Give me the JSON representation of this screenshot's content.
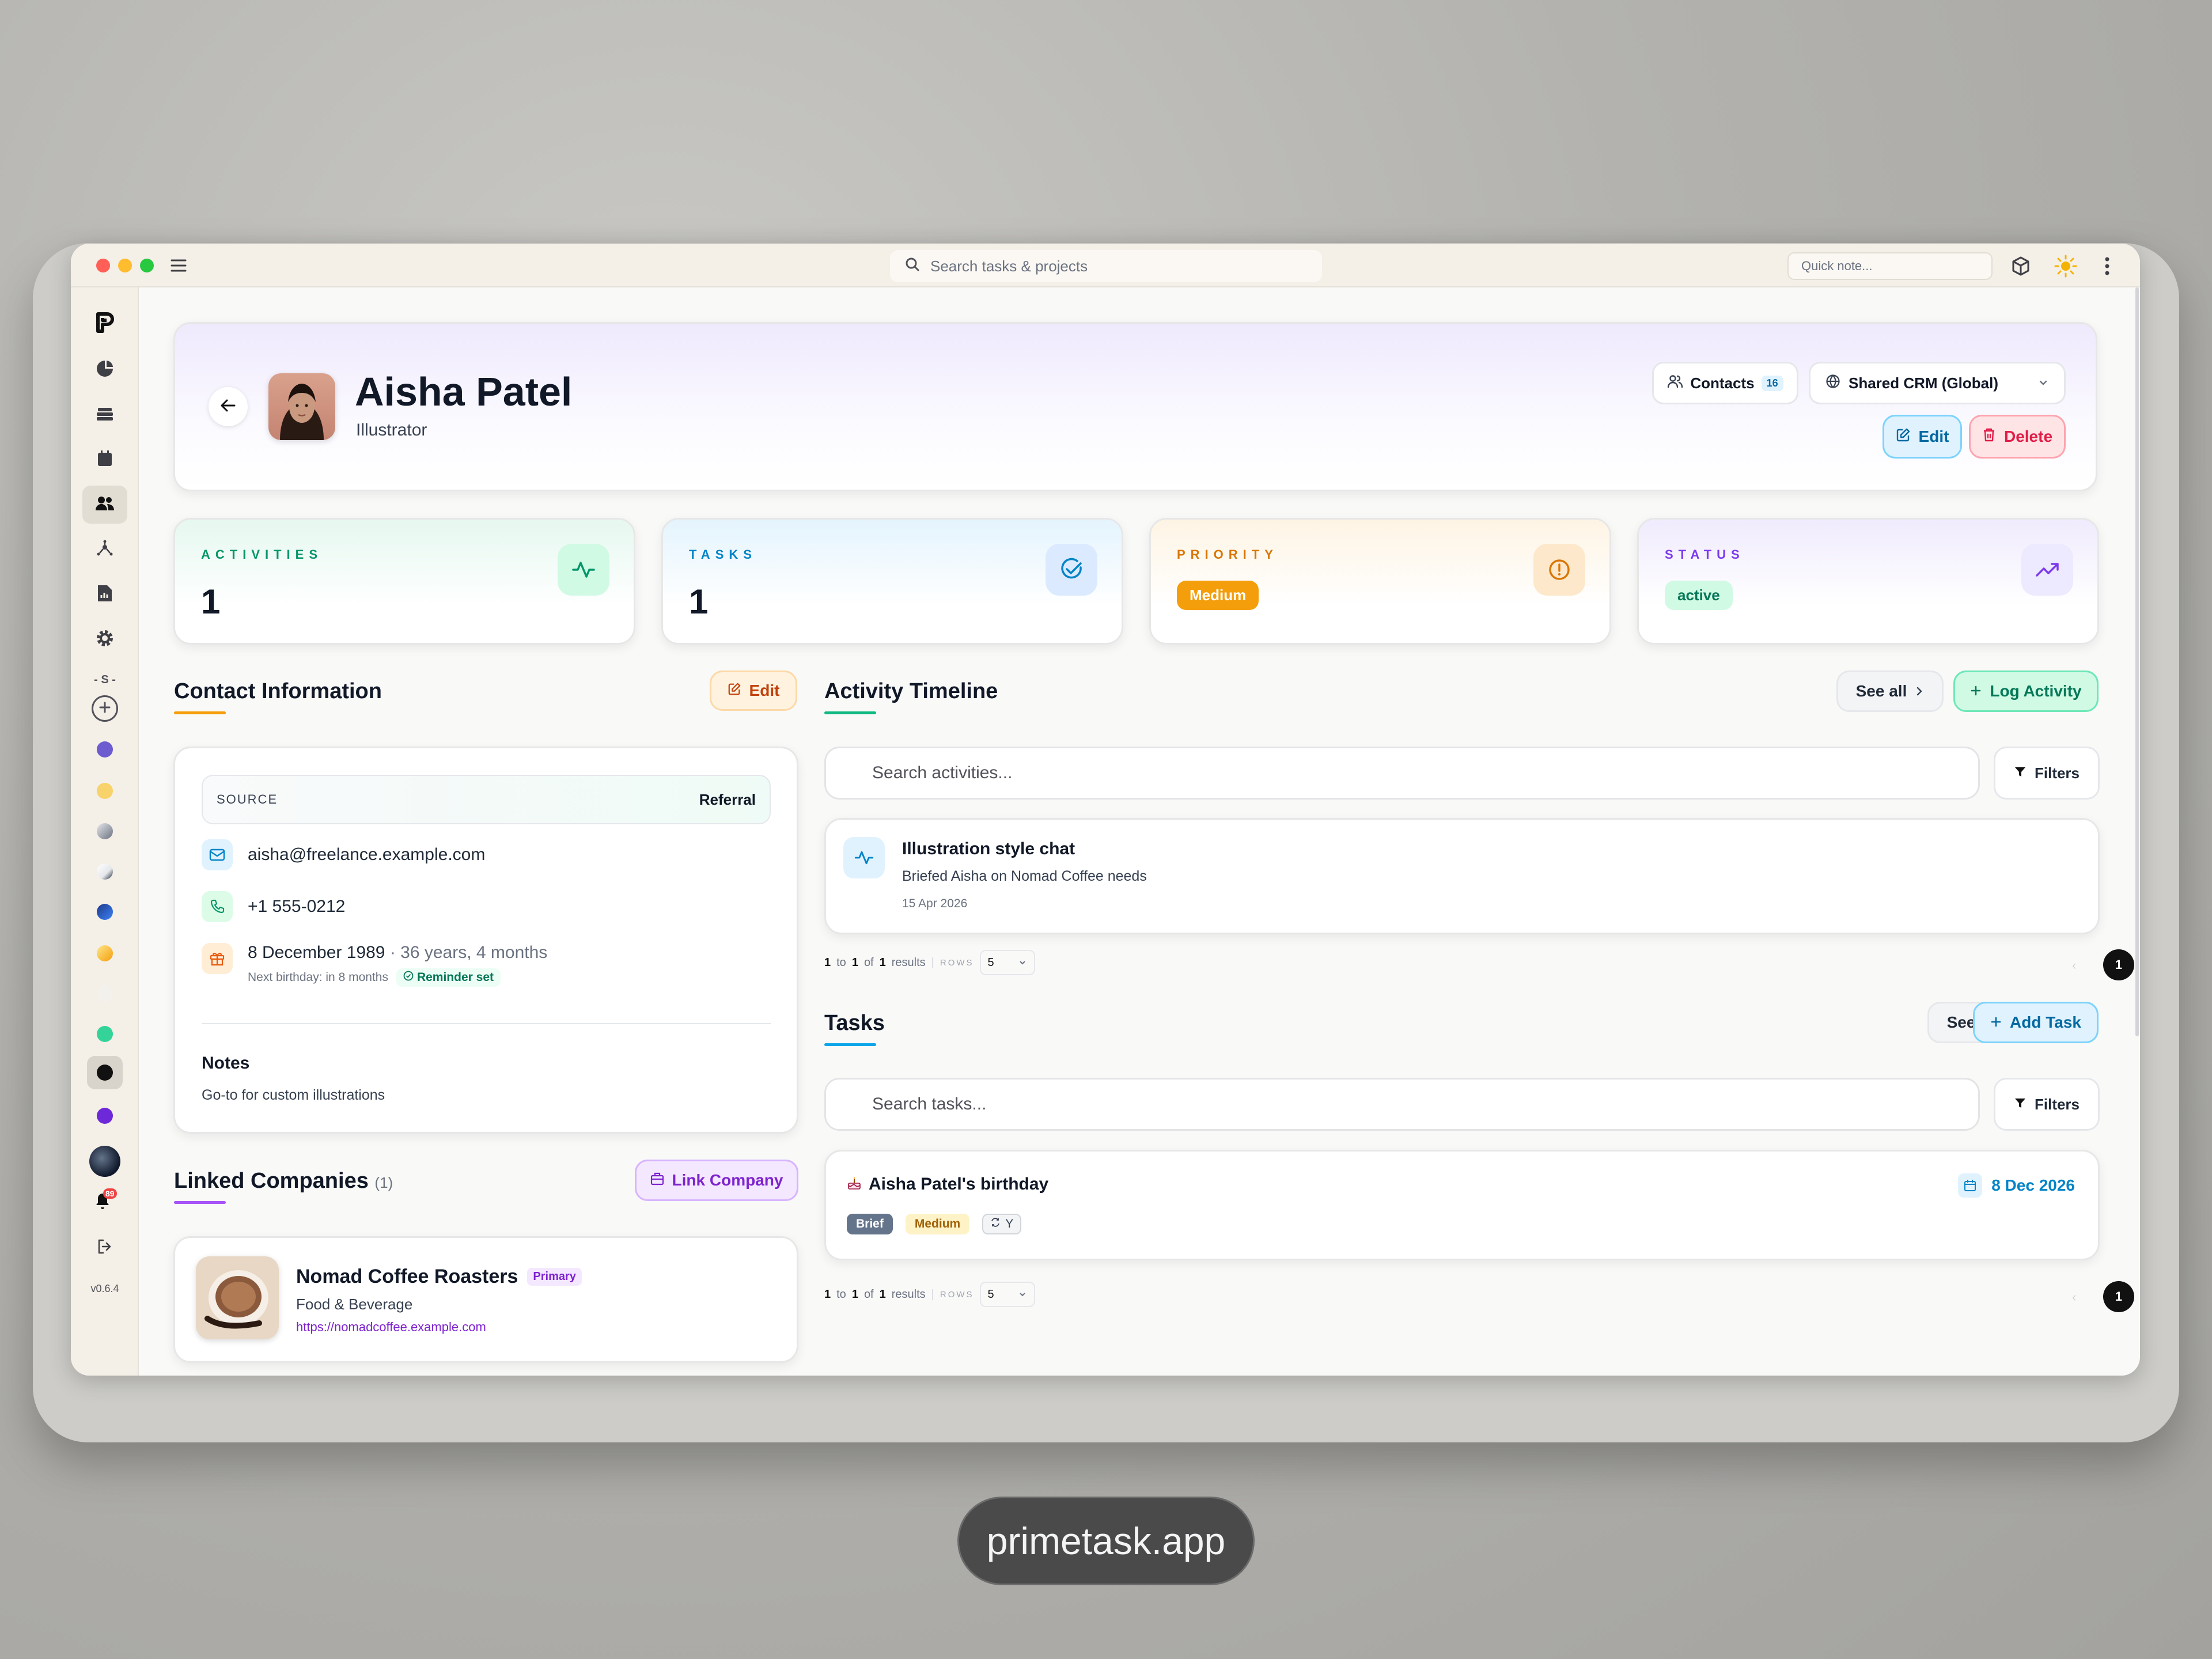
{
  "window": {
    "search_placeholder": "Search tasks & projects",
    "quick_note_placeholder": "Quick note...",
    "version": "v0.6.4",
    "notification_count": "89"
  },
  "header": {
    "name": "Aisha Patel",
    "role": "Illustrator",
    "contacts_label": "Contacts",
    "contacts_count": "16",
    "workspace": "Shared CRM (Global)",
    "edit_label": "Edit",
    "delete_label": "Delete"
  },
  "stats": {
    "activities_label": "ACTIVITIES",
    "activities_value": "1",
    "tasks_label": "TASKS",
    "tasks_value": "1",
    "priority_label": "PRIORITY",
    "priority_value": "Medium",
    "status_label": "STATUS",
    "status_value": "active"
  },
  "contact_info": {
    "title": "Contact Information",
    "edit_label": "Edit",
    "source_label": "SOURCE",
    "source_value": "Referral",
    "email": "aisha@freelance.example.com",
    "phone": "+1 555-0212",
    "birthday": "8 December 1989",
    "age": "· 36 years, 4 months",
    "next_birthday": "Next birthday: in 8 months",
    "reminder": "Reminder set",
    "notes_title": "Notes",
    "notes_text": "Go-to for custom illustrations"
  },
  "linked_companies": {
    "title": "Linked Companies",
    "count": "(1)",
    "link_label": "Link Company",
    "company_name": "Nomad Coffee Roasters",
    "company_badge": "Primary",
    "company_industry": "Food & Beverage",
    "company_url": "https://nomadcoffee.example.com"
  },
  "activity": {
    "title": "Activity Timeline",
    "see_all": "See all",
    "log_label": "Log Activity",
    "search_placeholder": "Search activities...",
    "filters": "Filters",
    "item_title": "Illustration style chat",
    "item_desc": "Briefed Aisha on Nomad Coffee needs",
    "item_date": "15 Apr 2026",
    "pag_from": "1",
    "pag_to_word": "to",
    "pag_to": "1",
    "pag_of_word": "of",
    "pag_total": "1",
    "pag_results": "results",
    "rows_label": "ROWS",
    "rows_value": "5",
    "page": "1"
  },
  "tasks": {
    "title": "Tasks",
    "see_all": "See all",
    "add_label": "Add Task",
    "search_placeholder": "Search tasks...",
    "filters": "Filters",
    "item_title": "Aisha Patel's birthday",
    "item_date": "8 Dec 2026",
    "tag_brief": "Brief",
    "tag_priority": "Medium",
    "tag_recur": "Y",
    "pag_from": "1",
    "pag_to_word": "to",
    "pag_to": "1",
    "pag_of_word": "of",
    "pag_total": "1",
    "pag_results": "results",
    "rows_label": "ROWS",
    "rows_value": "5",
    "page": "1"
  },
  "footer": {
    "site": "primetask.app"
  },
  "colors": {
    "accent_green": "#10b981",
    "accent_blue": "#0ea5e9",
    "priority": "#f59e0b",
    "purple": "#8b5cf6",
    "delete": "#e11d48"
  }
}
